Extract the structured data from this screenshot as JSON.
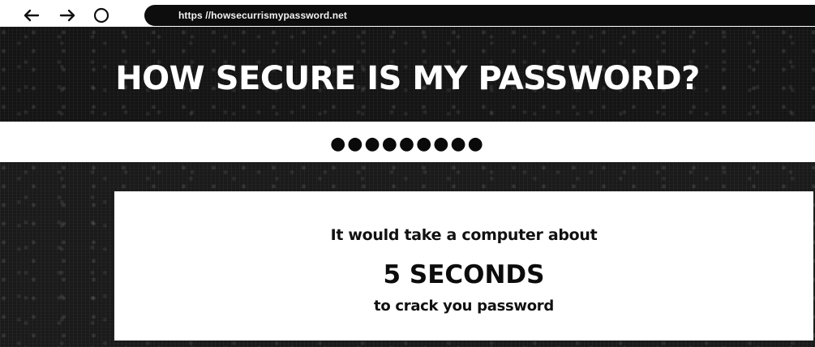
{
  "browser": {
    "url": "https //howsecurrismypassword.net",
    "icons": {
      "back": "arrow-left-icon",
      "forward": "arrow-right-icon",
      "refresh": "refresh-circle-icon"
    }
  },
  "header": {
    "title": "HOW SECURE IS MY PASSWORD?"
  },
  "password_field": {
    "value": "●●●●●●●●●"
  },
  "result": {
    "lead": "It would take a computer about",
    "time": "5 SECONDS",
    "tail": "to crack you password"
  },
  "colors": {
    "header_background": "#141414",
    "result_background": "#1a1a1a",
    "card_background": "#ffffff",
    "text_dark": "#111111",
    "title_text": "#ffffff"
  }
}
